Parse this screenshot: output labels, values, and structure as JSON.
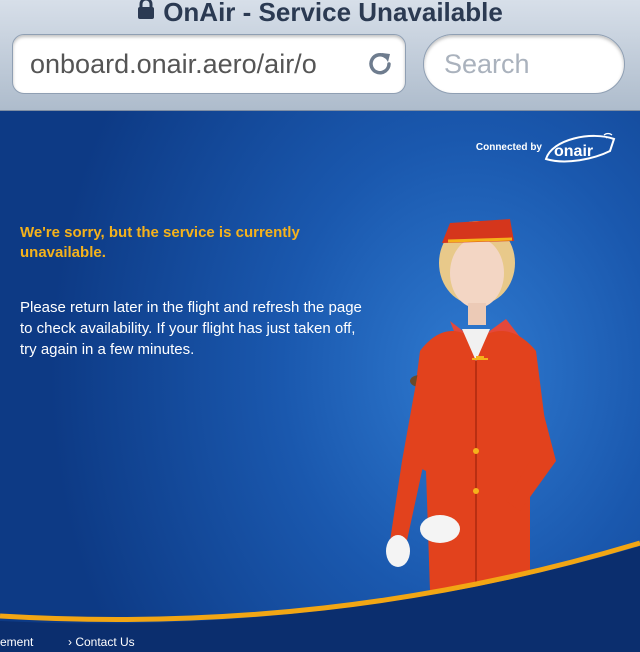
{
  "browser": {
    "title": "OnAir - Service Unavailable",
    "url": "onboard.onair.aero/air/o",
    "search_placeholder": "Search"
  },
  "header": {
    "connected_label": "Connected by",
    "logo_text": "onair"
  },
  "message": {
    "heading": "We're sorry, but the service is currently unavailable.",
    "body": "Please return later in the flight and refresh the page to check availability. If your flight has just taken off, try again in a few minutes."
  },
  "footer": {
    "links": [
      "ement",
      "› Contact Us"
    ]
  },
  "colors": {
    "accent": "#f5b21b",
    "background": "#1a58ae",
    "swoosh": "#f2a614"
  }
}
